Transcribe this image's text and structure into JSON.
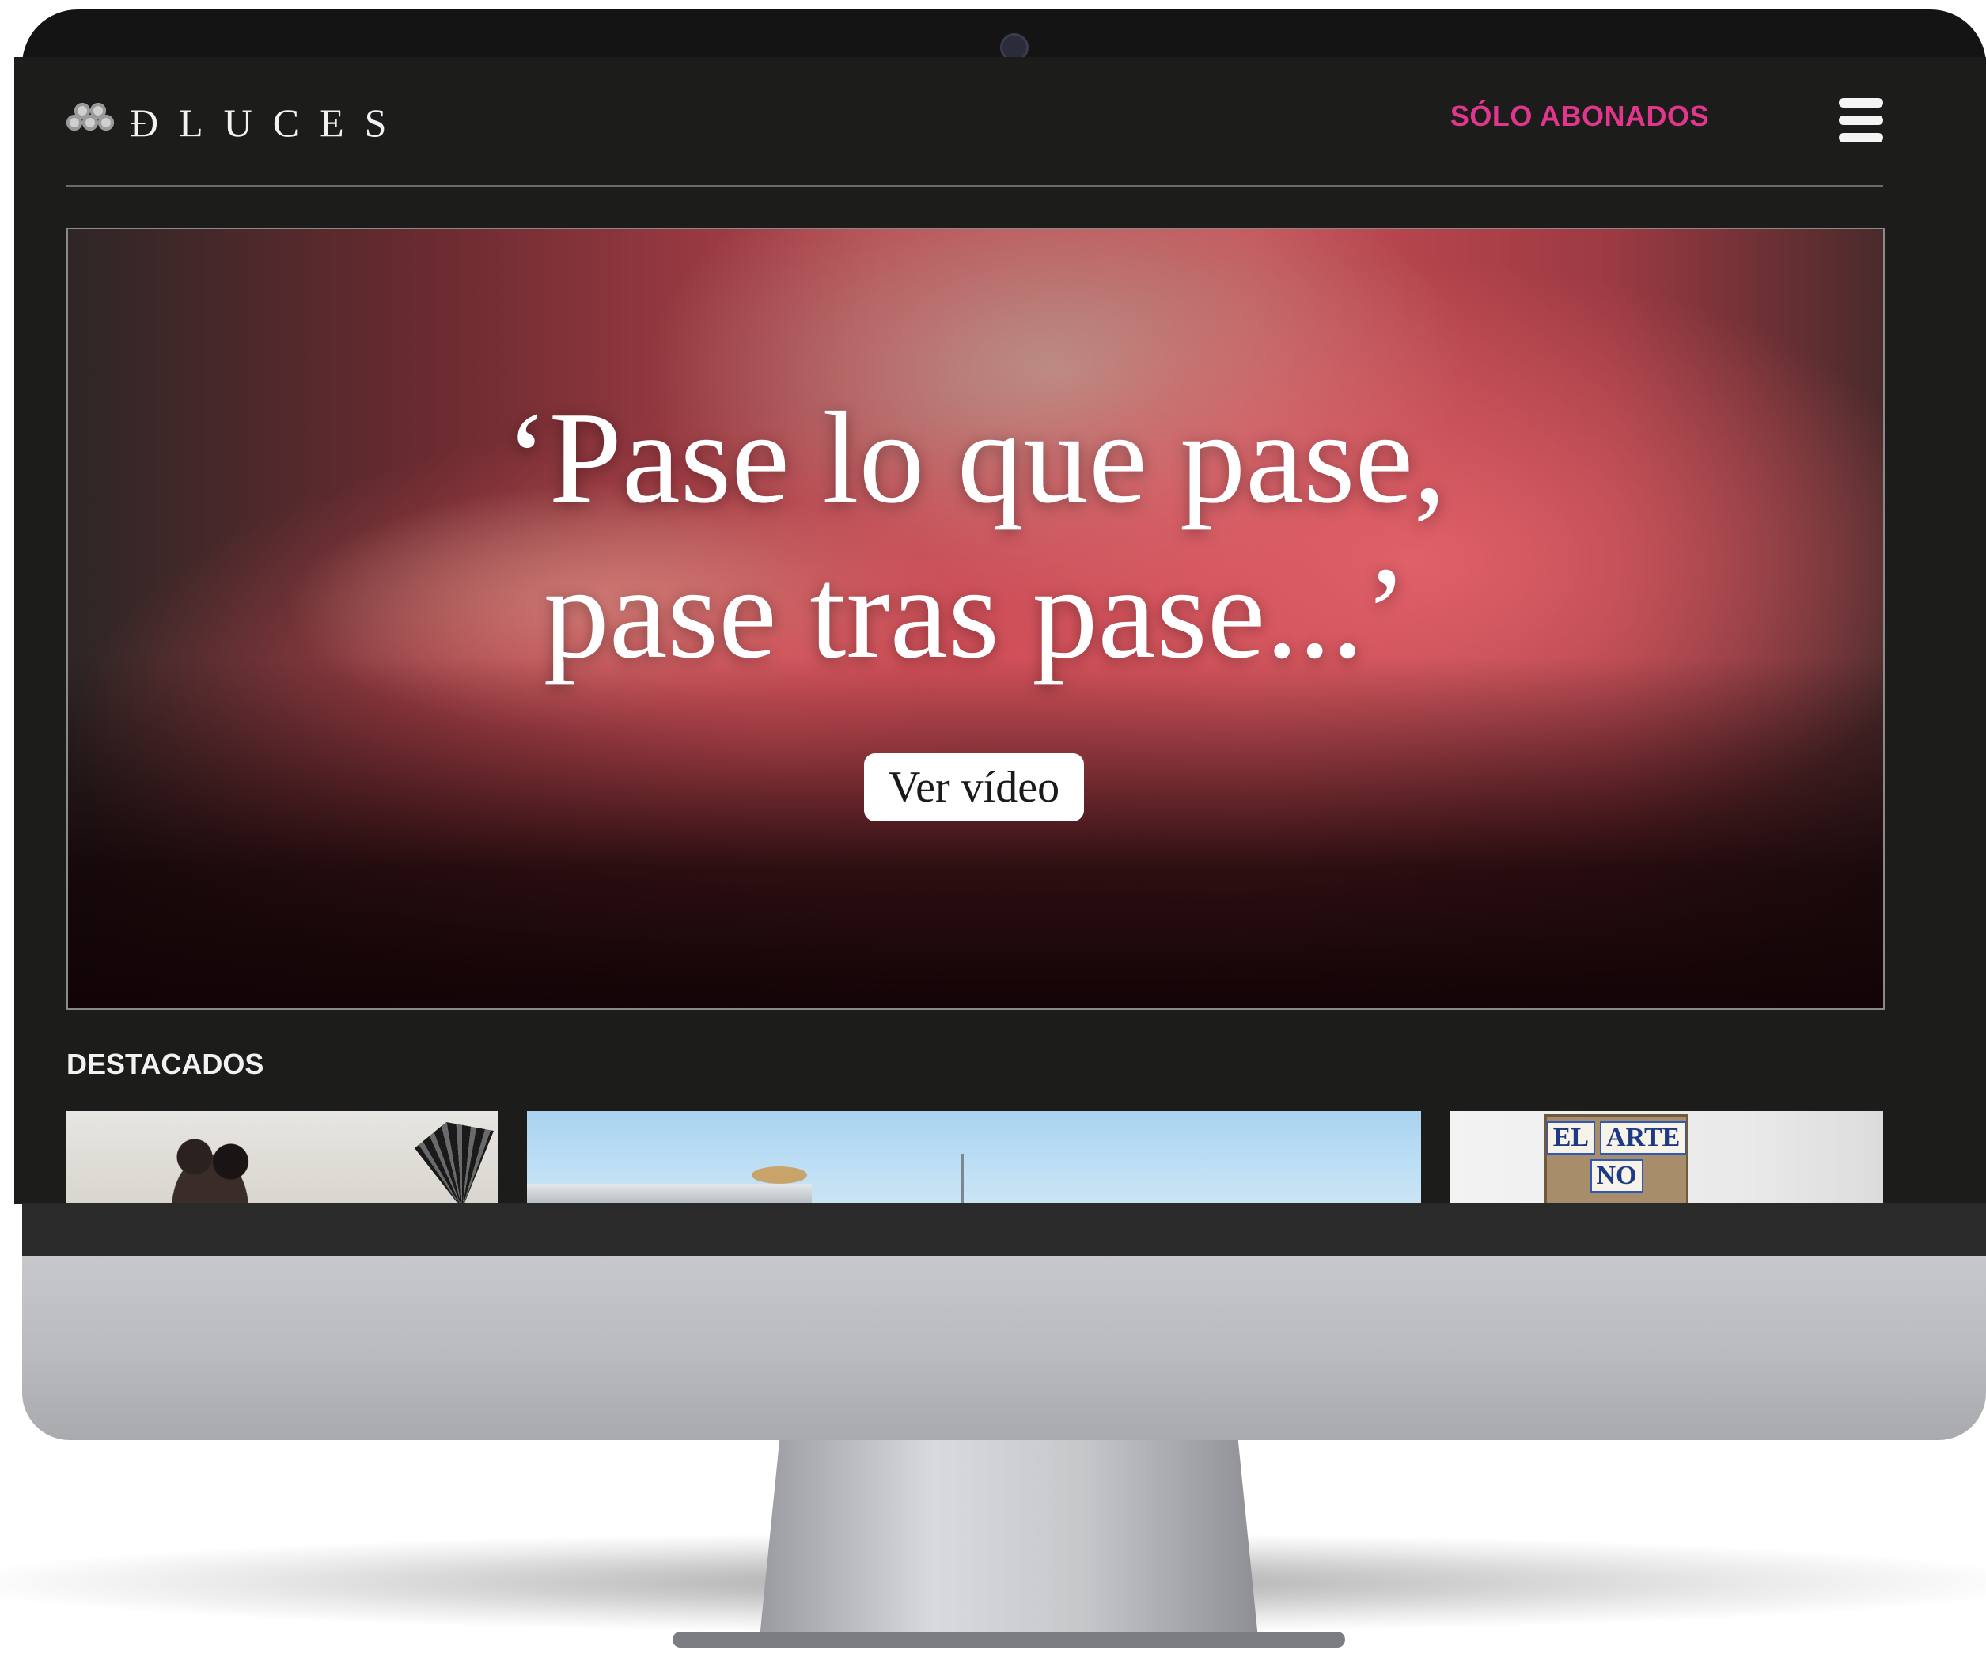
{
  "header": {
    "logo_text": "ÐLUCES",
    "subscribers_link": "SÓLO ABONADOS",
    "menu_icon": "hamburger-icon"
  },
  "hero": {
    "quote_line_1": "‘Pase lo que pase,",
    "quote_line_2": "pase tras pase...’",
    "button_label": "Ver vídeo"
  },
  "featured": {
    "title": "DESTACADOS",
    "cards": [
      {
        "sign_line_1_a": "",
        "sign_line_1_b": "",
        "sign_line_2": ""
      },
      {
        "sign_line_1_a": "",
        "sign_line_1_b": "",
        "sign_line_2": ""
      },
      {
        "sign_line_1_a": "EL",
        "sign_line_1_b": "ARTE",
        "sign_line_2": "NO"
      }
    ]
  },
  "colors": {
    "accent": "#e0368c",
    "background": "#1c1c1b",
    "text": "#f2f2f2"
  }
}
